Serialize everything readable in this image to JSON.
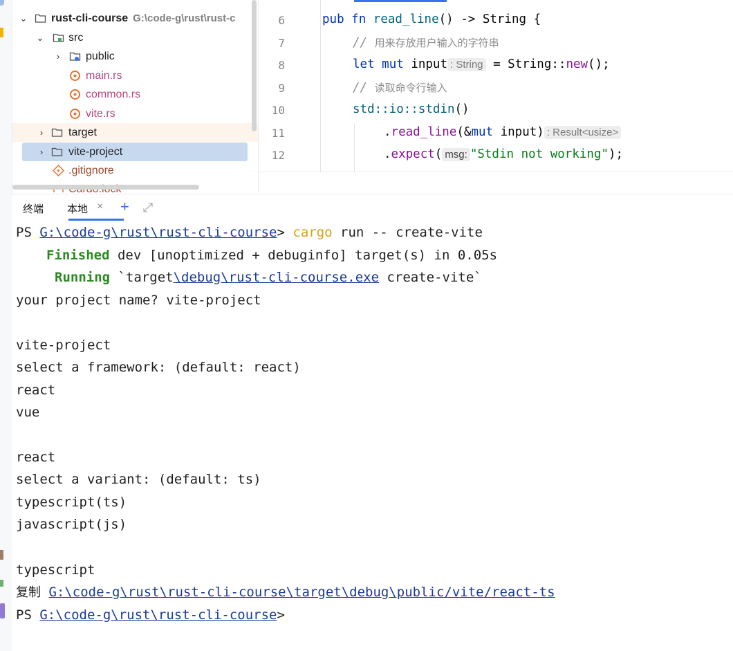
{
  "project_tree": {
    "root": {
      "name": "rust-cli-course",
      "path_hint": "G:\\code-g\\rust\\rust-c"
    },
    "items": [
      {
        "label": "src"
      },
      {
        "label": "public"
      },
      {
        "label": "main.rs"
      },
      {
        "label": "common.rs"
      },
      {
        "label": "vite.rs"
      },
      {
        "label": "target"
      },
      {
        "label": "vite-project"
      },
      {
        "label": ".gitignore"
      },
      {
        "label": "Cargo.lock"
      }
    ]
  },
  "editor": {
    "line_numbers": [
      "6",
      "7",
      "8",
      "9",
      "10",
      "11",
      "12"
    ],
    "lines": {
      "l6": {
        "kw_pub": "pub",
        "kw_fn": "fn",
        "name": "read_line",
        "rest": "() -> String {"
      },
      "l7": {
        "slashes": "// ",
        "comment": "用来存放用户输入的字符串"
      },
      "l8": {
        "kw_let": "let",
        "kw_mut": "mut",
        "var": "input",
        "hint": ": String",
        "rest": " = String::",
        "method": "new",
        "end": "();"
      },
      "l9": {
        "slashes": "// ",
        "comment": "读取命令行输入"
      },
      "l10": {
        "ns": "std::io::stdin",
        "rest": "()"
      },
      "l11": {
        "dot": ".",
        "method": "read_line",
        "open": "(&",
        "kw_mut": "mut",
        "arg": " input)",
        "hint": ": Result<usize>"
      },
      "l12": {
        "dot": ".",
        "method": "expect",
        "open": "(",
        "param": "msg:",
        "str": "\"Stdin not working\"",
        "end": ");"
      }
    }
  },
  "terminal": {
    "tabs": {
      "terminal_label": "终端",
      "local_label": "本地"
    },
    "lines": {
      "t1": {
        "ps": "PS ",
        "path": "G:\\code-g\\rust\\rust-cli-course",
        "gt": "> ",
        "cmd": "cargo",
        "args": " run -- create-vite"
      },
      "t2": {
        "status": "Finished",
        "text": " dev [unoptimized + debuginfo] target(s) in 0.05s"
      },
      "t3": {
        "status": "Running",
        "pre": " `target",
        "link": "\\debug\\rust-cli-course.exe",
        "post": " create-vite`"
      },
      "t4": "your project name? vite-project",
      "t5": "vite-project",
      "t6": "select a framework: (default: react)",
      "t7": "react",
      "t8": "vue",
      "t9": "react",
      "t10": "select a variant: (default: ts)",
      "t11": "typescript(ts)",
      "t12": "javascript(js)",
      "t13": "typescript",
      "t14": {
        "copy": "复制",
        "path": "G:\\code-g\\rust\\rust-cli-course\\target\\debug\\public/vite/react-ts"
      },
      "t15": {
        "ps": "PS ",
        "path": "G:\\code-g\\rust\\rust-cli-course",
        "gt": ">"
      }
    }
  },
  "colors": {
    "accent": "#3574f0",
    "selection": "#c7d9ef",
    "terminal_link": "#1a3a99",
    "terminal_green": "#2a8a1f",
    "terminal_yellow": "#d4a017"
  }
}
